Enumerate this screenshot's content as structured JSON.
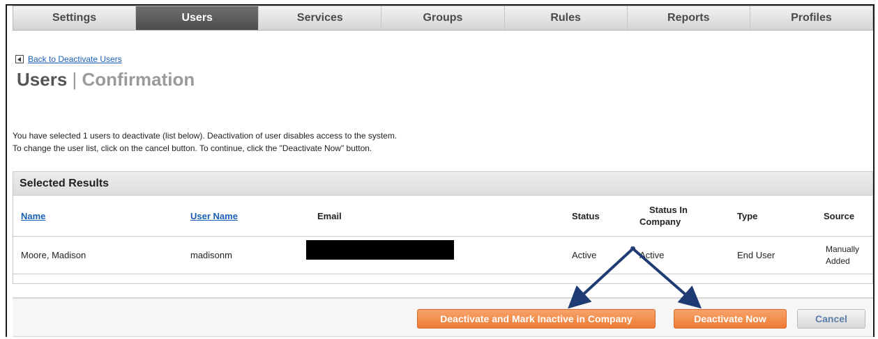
{
  "tabs": [
    {
      "label": "Settings",
      "active": false
    },
    {
      "label": "Users",
      "active": true
    },
    {
      "label": "Services",
      "active": false
    },
    {
      "label": "Groups",
      "active": false
    },
    {
      "label": "Rules",
      "active": false
    },
    {
      "label": "Reports",
      "active": false
    },
    {
      "label": "Profiles",
      "active": false
    }
  ],
  "header": {
    "back_link": "Back to Deactivate Users",
    "title": "Users",
    "title_separator": "|",
    "subtitle": "Confirmation"
  },
  "instructions": [
    "You have selected 1 users to deactivate (list below). Deactivation of user disables access to the system.",
    "To change the user list, click on the cancel button. To continue, click the \"Deactivate Now\" button."
  ],
  "results": {
    "title": "Selected Results",
    "columns": {
      "name": "Name",
      "user_name": "User Name",
      "email": "Email",
      "status": "Status",
      "status_in_company_1": "Status In",
      "status_in_company_2": "Company",
      "type": "Type",
      "source": "Source"
    },
    "rows": [
      {
        "name": "Moore, Madison",
        "user_name": "madisonm",
        "email": "",
        "status": "Active",
        "status_in_company": "Active",
        "type": "End User",
        "source_1": "Manually",
        "source_2": "Added"
      }
    ]
  },
  "buttons": {
    "deactivate_mark_inactive": "Deactivate and Mark Inactive in Company",
    "deactivate_now": "Deactivate Now",
    "cancel": "Cancel"
  },
  "colors": {
    "accent_orange": "#ee7b33",
    "link_blue": "#1a5fb4",
    "active_tab": "#555555",
    "annotation_arrow": "#1f3b73"
  }
}
